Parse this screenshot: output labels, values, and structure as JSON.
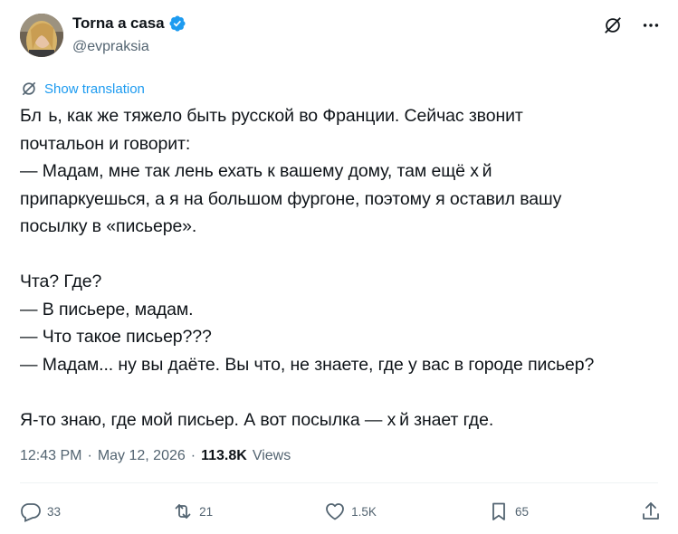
{
  "author": {
    "name": "Torna a casa",
    "handle": "@evpraksia",
    "verified": true
  },
  "colors": {
    "accent": "#1d9bf0",
    "text": "#0f1419",
    "muted": "#536471"
  },
  "translate_label": "Show translation",
  "body_lines": [
    "Бл  ь, как же тяжело быть русской во Франции. Сейчас звонит",
    "почтальон и говорит:",
    "— Мадам, мне так лень ехать к вашему дому, там ещё х й",
    "припаркуешься, а я на большом фургоне, поэтому я оставил вашу",
    "посылку в «письере».",
    "",
    "Чта? Где?",
    "— В письере, мадам.",
    "— Что такое письер???",
    "— Мадам... ну вы даёте. Вы что, не знаете, где у вас в городе письер?",
    "",
    "Я-то знаю, где мой письер. А вот посылка — х й знает где."
  ],
  "meta": {
    "time": "12:43 PM",
    "separator": "·",
    "date": "May 12, 2026",
    "views_count": "113.8K",
    "views_label": "Views"
  },
  "actions": {
    "replies": "33",
    "reposts": "21",
    "likes": "1.5K",
    "bookmarks": "65"
  }
}
